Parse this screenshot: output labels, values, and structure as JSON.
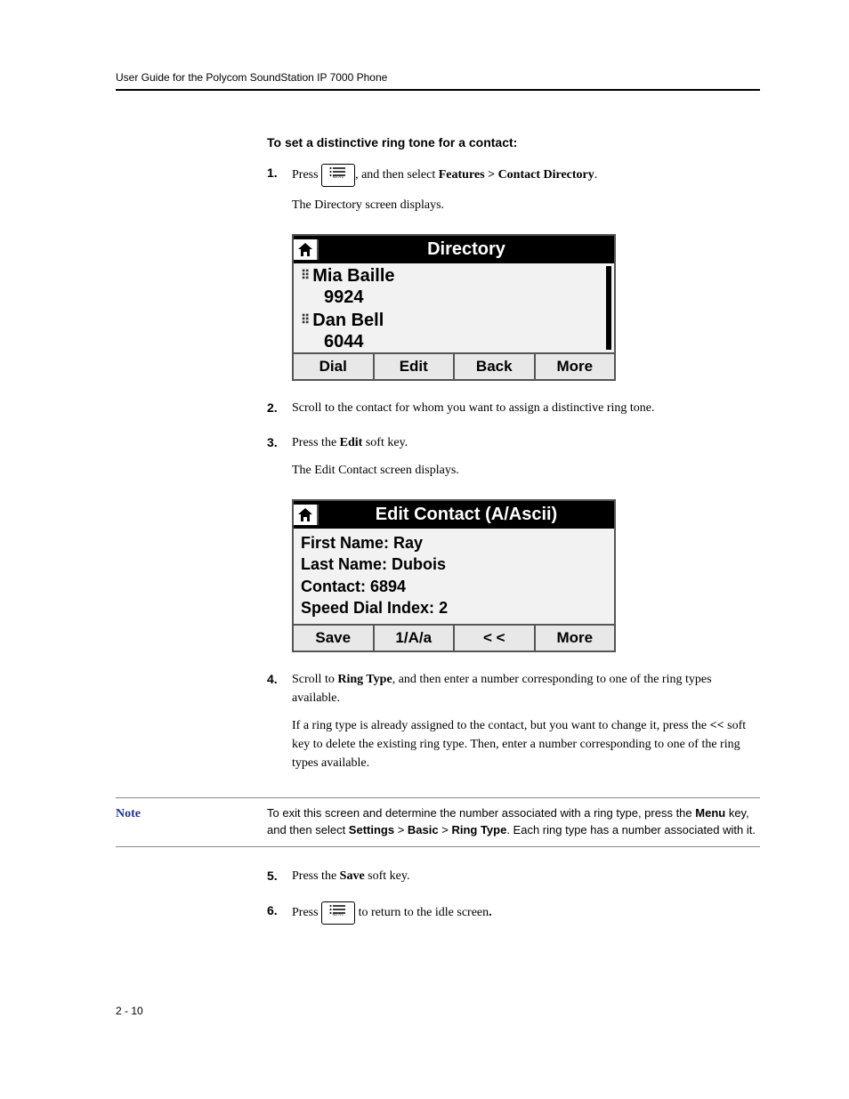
{
  "header": "User Guide for the Polycom SoundStation IP 7000 Phone",
  "subheading": "To set a distinctive ring tone for a contact:",
  "step1_a": "Press ",
  "step1_b": ", and then select ",
  "step1_c": "Features > Contact Directory",
  "step1_d": ".",
  "step1_p2": "The Directory screen displays.",
  "screen1": {
    "title": "Directory",
    "entry1_name": "Mia Baille",
    "entry1_ext": "9924",
    "entry2_name": "Dan Bell",
    "entry2_ext": "6044",
    "softkeys": [
      "Dial",
      "Edit",
      "Back",
      "More"
    ]
  },
  "step2": "Scroll to the contact for whom you want to assign a distinctive ring tone.",
  "step3_a": "Press the ",
  "step3_b": "Edit",
  "step3_c": " soft key.",
  "step3_p2": "The Edit Contact screen displays.",
  "screen2": {
    "title": "Edit Contact (A/Ascii)",
    "fields": {
      "first_label": "First Name:",
      "first_val": "Ray",
      "last_label": "Last Name:",
      "last_val": "Dubois",
      "contact_label": "Contact:",
      "contact_val": "6894",
      "sdi_label": "Speed Dial Index:",
      "sdi_val": "2"
    },
    "softkeys": [
      "Save",
      "1/A/a",
      "< <",
      "More"
    ]
  },
  "step4_a": "Scroll to ",
  "step4_b": "Ring Type",
  "step4_c": ", and then enter a number corresponding to one of the ring types available.",
  "step4_p2a": "If a ring type is already assigned to the contact, but you want to change it, press the ",
  "step4_p2b": "<<",
  "step4_p2c": " soft key to delete the existing ring type. Then, enter a number corresponding to one of the ring types available.",
  "note_label": "Note",
  "note_a": "To exit this screen and determine the number associated with a ring type, press the ",
  "note_b": "Menu",
  "note_c": " key, and then select ",
  "note_d": "Settings",
  "note_e": " > ",
  "note_f": "Basic",
  "note_g": " > ",
  "note_h": "Ring Type",
  "note_i": ". Each ring type has a number associated with it.",
  "step5_a": "Press the ",
  "step5_b": "Save",
  "step5_c": " soft key.",
  "step6_a": "Press ",
  "step6_b": " to return to the idle screen",
  "step6_c": ".",
  "pagenum": "2 - 10",
  "menu_key_label": "MENU"
}
